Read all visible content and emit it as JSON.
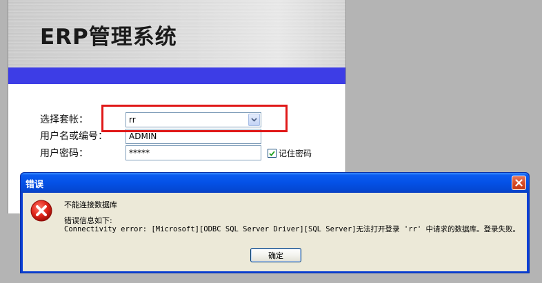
{
  "login": {
    "app_title": "ERP管理系统",
    "labels": {
      "account": "选择套帐：",
      "user": "用户名或编号：",
      "password": "用户密码："
    },
    "fields": {
      "account_value": "rr",
      "user_value": "ADMIN",
      "password_value": "*****"
    },
    "remember_password": {
      "label": "记住密码",
      "checked": true
    },
    "icons": {
      "dropdown": "chevron-down-icon",
      "checkbox": "checkmark-icon"
    }
  },
  "dialog": {
    "title": "错误",
    "icon": "error-icon",
    "close_icon": "close-icon",
    "message_main": "不能连接数据库",
    "message_detail_heading": "错误信息如下:",
    "message_detail": "Connectivity error: [Microsoft][ODBC SQL Server Driver][SQL Server]无法打开登录 'rr' 中请求的数据库。登录失败。",
    "ok_label": "确定"
  },
  "colors": {
    "accent_stripe": "#3d3de6",
    "highlight": "#e01818",
    "titlebar": "#0451e6",
    "dialog_body": "#ece9d8",
    "desktop": "#b4b4b4"
  }
}
